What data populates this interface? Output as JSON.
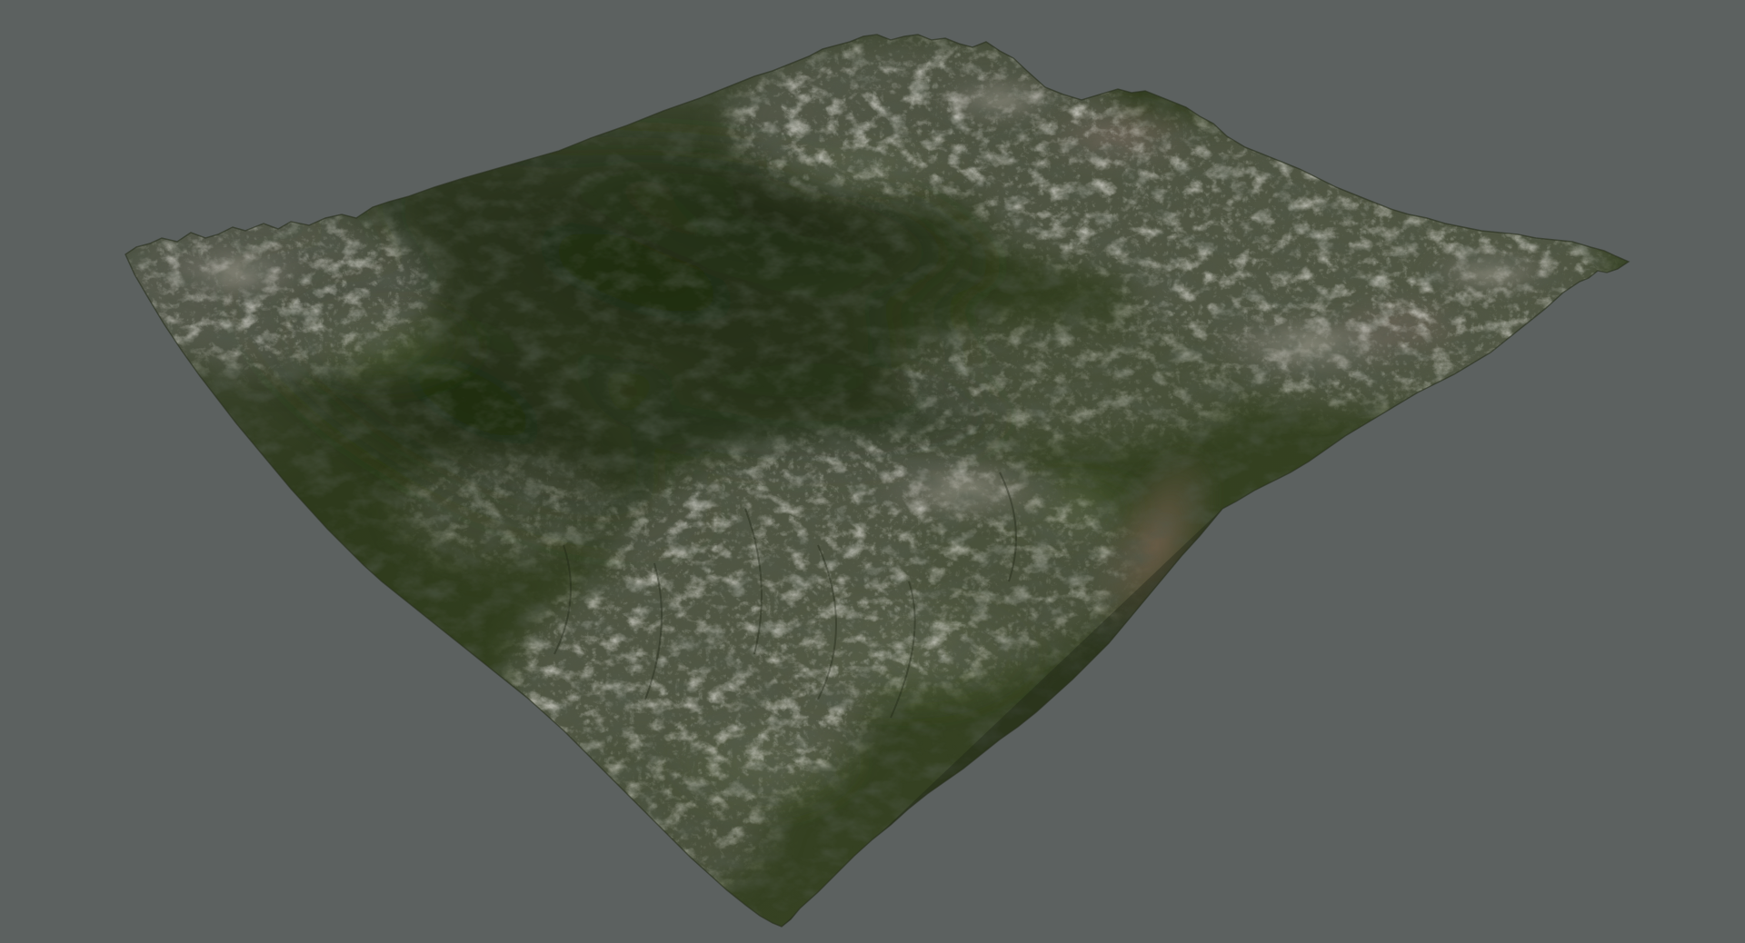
{
  "scene": {
    "background_color": "#5c6160",
    "subject": "terrain-mesh",
    "palette": {
      "valley_dark": "#1f2814",
      "valley_green": "#2e3a1a",
      "moss": "#3e4f26",
      "rock_shadow": "#2a2d2c",
      "rock_mid": "#6b6a64",
      "rock_light": "#b8b5a9",
      "ridge_brown": "#6a5a4c"
    }
  }
}
